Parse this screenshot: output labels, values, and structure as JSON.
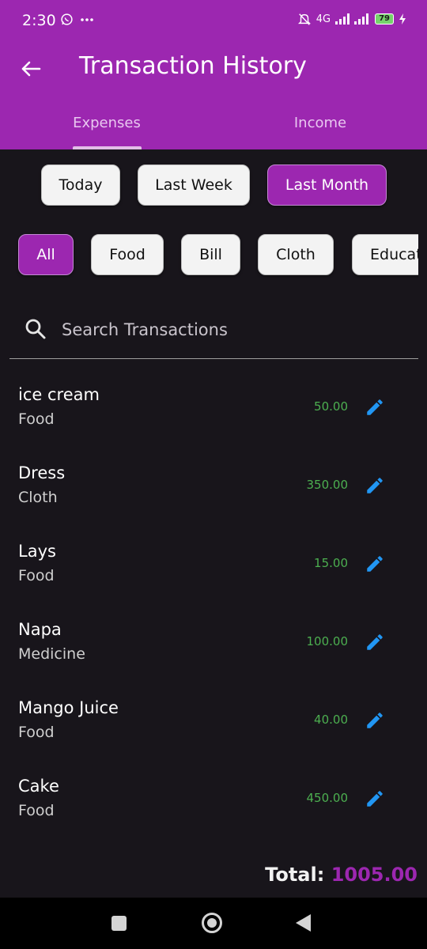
{
  "status_bar": {
    "time": "2:30",
    "network": "4G",
    "battery": "79"
  },
  "app_bar": {
    "title": "Transaction History"
  },
  "tabs": [
    {
      "label": "Expenses",
      "selected": true
    },
    {
      "label": "Income",
      "selected": false
    }
  ],
  "period_filters": [
    {
      "label": "Today",
      "selected": false
    },
    {
      "label": "Last Week",
      "selected": false
    },
    {
      "label": "Last Month",
      "selected": true
    }
  ],
  "category_filters": [
    {
      "label": "All",
      "selected": true
    },
    {
      "label": "Food",
      "selected": false
    },
    {
      "label": "Bill",
      "selected": false
    },
    {
      "label": "Cloth",
      "selected": false
    },
    {
      "label": "Education",
      "selected": false
    }
  ],
  "search": {
    "placeholder": "Search Transactions",
    "value": ""
  },
  "transactions": [
    {
      "name": "ice cream",
      "category": "Food",
      "amount": "50.00"
    },
    {
      "name": "Dress",
      "category": "Cloth",
      "amount": "350.00"
    },
    {
      "name": "Lays",
      "category": "Food",
      "amount": "15.00"
    },
    {
      "name": "Napa",
      "category": "Medicine",
      "amount": "100.00"
    },
    {
      "name": "Mango Juice",
      "category": "Food",
      "amount": "40.00"
    },
    {
      "name": "Cake",
      "category": "Food",
      "amount": "450.00"
    }
  ],
  "total": {
    "label": "Total:",
    "value": "1005.00"
  },
  "colors": {
    "primary": "#9c27b0",
    "background": "#18151b",
    "amount": "#4caf50",
    "edit_icon": "#2196f3"
  },
  "icons": {
    "back": "arrow-left-icon",
    "search": "magnifier-icon",
    "edit": "pencil-icon"
  }
}
